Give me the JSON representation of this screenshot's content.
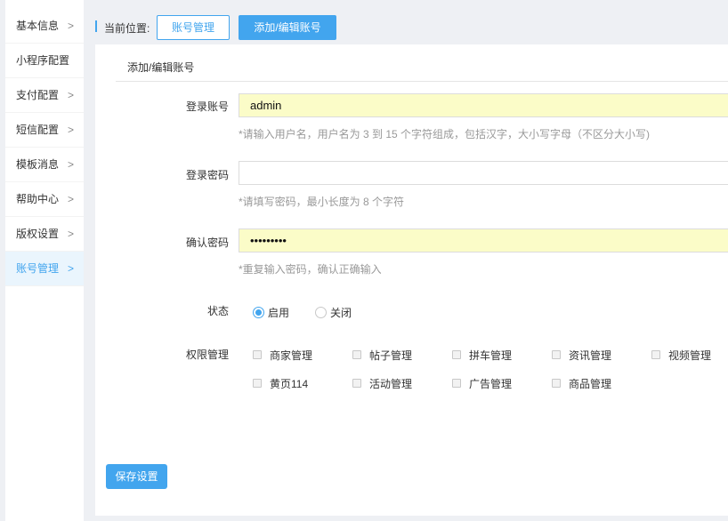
{
  "sidebar": {
    "items": [
      {
        "label": "基本信息",
        "chevron": ">"
      },
      {
        "label": "小程序配置",
        "chevron": ""
      },
      {
        "label": "支付配置",
        "chevron": ">"
      },
      {
        "label": "短信配置",
        "chevron": ">"
      },
      {
        "label": "模板消息",
        "chevron": ">"
      },
      {
        "label": "帮助中心",
        "chevron": ">"
      },
      {
        "label": "版权设置",
        "chevron": ">"
      },
      {
        "label": "账号管理",
        "chevron": ">",
        "active": true
      }
    ]
  },
  "breadcrumb": {
    "label": "当前位置:",
    "items": [
      "账号管理",
      "添加/编辑账号"
    ]
  },
  "form": {
    "title": "添加/编辑账号",
    "username": {
      "label": "登录账号",
      "value": "admin",
      "hint": "*请输入用户名，用户名为 3 到 15 个字符组成，包括汉字，大小写字母（不区分大小写)"
    },
    "password": {
      "label": "登录密码",
      "value": "",
      "hint": "*请填写密码，最小长度为 8 个字符"
    },
    "confirm": {
      "label": "确认密码",
      "value": "•••••••••",
      "hint": "*重复输入密码，确认正确输入"
    },
    "status": {
      "label": "状态",
      "options": [
        "启用",
        "关闭"
      ],
      "selected": "启用"
    },
    "permissions": {
      "label": "权限管理",
      "items": [
        "商家管理",
        "帖子管理",
        "拼车管理",
        "资讯管理",
        "视频管理",
        "黄页114",
        "活动管理",
        "广告管理",
        "商品管理"
      ]
    },
    "save_label": "保存设置"
  },
  "colors": {
    "accent": "#42a5ee",
    "filled_input": "#fbfcc8",
    "hint": "#999999"
  }
}
